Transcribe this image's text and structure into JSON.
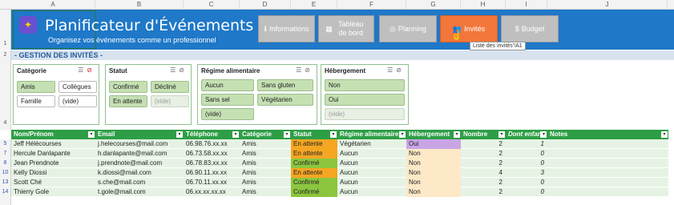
{
  "columns": [
    "A",
    "B",
    "C",
    "D",
    "E",
    "F",
    "G",
    "H",
    "I",
    "J"
  ],
  "rows": [
    "1",
    "2",
    "3",
    "4",
    "5",
    "7",
    "8",
    "10",
    "13",
    "14"
  ],
  "header": {
    "title": "Planificateur d'Événements",
    "subtitle": "Organisez vos événements comme un professionnel",
    "logo_icon": "party-icon"
  },
  "nav": [
    {
      "label": "Informations",
      "icon": "info-icon",
      "glyph": "ℹ"
    },
    {
      "label": "Tableau de bord",
      "icon": "dashboard-icon",
      "glyph": "▦"
    },
    {
      "label": "Planning",
      "icon": "target-icon",
      "glyph": "◎"
    },
    {
      "label": "Invités",
      "icon": "people-icon",
      "glyph": "👥"
    },
    {
      "label": "Budget",
      "icon": "money-bag-icon",
      "glyph": "$"
    }
  ],
  "tooltip": "Liste des invités'!A1",
  "section_title": "- GESTION DES INVITÉS -",
  "slicers": {
    "categorie": {
      "title": "Catégorie",
      "items": [
        "Amis",
        "Collègues",
        "Famille",
        "(vide)"
      ]
    },
    "statut": {
      "title": "Statut",
      "items": [
        "Confirmé",
        "Décliné",
        "En attente",
        "(vide)"
      ]
    },
    "regime": {
      "title": "Régime alimentaire",
      "items": [
        "Aucun",
        "Sans gluten",
        "Sans sel",
        "Végétarien",
        "(vide)"
      ]
    },
    "hebergement": {
      "title": "Hébergement",
      "items": [
        "Non",
        "Oui",
        "(vide)"
      ]
    }
  },
  "table": {
    "headers": [
      "Nom/Prénom",
      "Email",
      "Téléphone",
      "Catégorie",
      "Statut",
      "Régime alimentaire",
      "Hébergement",
      "Nombre",
      "Dont enfant",
      "Notes"
    ],
    "rows": [
      [
        "Jeff Hélécourses",
        "j.helecourses@mail.com",
        "06.98.76.xx.xx",
        "Amis",
        "En attente",
        "Végétarien",
        "Oui",
        "2",
        "1",
        ""
      ],
      [
        "Hercule Danlapante",
        "h.danlapante@mail.com",
        "06.73.58.xx.xx",
        "Amis",
        "En attente",
        "Aucun",
        "Non",
        "2",
        "0",
        ""
      ],
      [
        "Jean Prendnote",
        "j.prendnote@mail.com",
        "06.78.83.xx.xx",
        "Amis",
        "Confirmé",
        "Aucun",
        "Non",
        "2",
        "0",
        ""
      ],
      [
        "Kelly Diossi",
        "k.diossi@mail.com",
        "06.90.11.xx.xx",
        "Amis",
        "En attente",
        "Aucun",
        "Non",
        "4",
        "3",
        ""
      ],
      [
        "Scott Ché",
        "s.che@mail.com",
        "06.70.11.xx.xx",
        "Amis",
        "Confirmé",
        "Aucun",
        "Non",
        "2",
        "0",
        ""
      ],
      [
        "Thierry Gole",
        "t.gole@mail.com",
        "06.xx.xx.xx.xx",
        "Amis",
        "Confirmé",
        "Aucun",
        "Non",
        "2",
        "0",
        ""
      ]
    ]
  }
}
